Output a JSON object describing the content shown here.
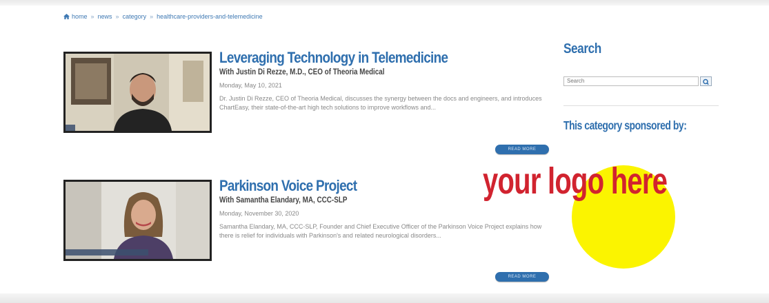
{
  "breadcrumb": {
    "items": [
      "home",
      "news",
      "category",
      "healthcare-providers-and-telemedicine"
    ],
    "separator": "»"
  },
  "articles": [
    {
      "title": "Leveraging Technology in Telemedicine",
      "subtitle": "With Justin Di Rezze, M.D., CEO of Theoria Medical",
      "date": "Monday, May 10, 2021",
      "excerpt": "Dr. Justin Di Rezze, CEO of Theoria Medical, discusses the synergy between the docs and engineers, and introduces ChartEasy, their state-of-the-art high tech solutions to improve workflows and...",
      "read_more": "READ MORE"
    },
    {
      "title": "Parkinson Voice Project",
      "subtitle": "With Samantha Elandary, MA, CCC-SLP",
      "date": "Monday, November 30, 2020",
      "excerpt": "Samantha Elandary, MA, CCC-SLP, Founder and Chief Executive Officer of the Parkinson Voice Project explains how there is relief for individuals with Parkinson's and related neurological disorders...",
      "read_more": "READ MORE"
    }
  ],
  "sidebar": {
    "search_title": "Search",
    "search_placeholder": "Search",
    "sponsor_title": "This category sponsored by:",
    "logo_text": "your logo here"
  },
  "colors": {
    "link_blue": "#2f6fae",
    "logo_red": "#d1232f",
    "logo_yellow": "#fbf400"
  }
}
